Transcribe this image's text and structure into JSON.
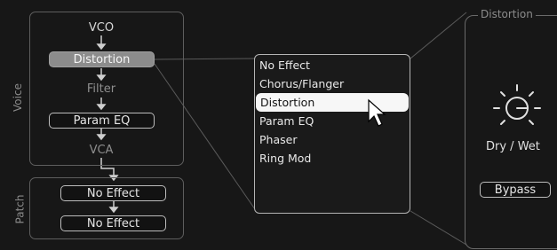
{
  "voice": {
    "group_label": "Voice",
    "chain": [
      "VCO",
      "Distortion",
      "Filter",
      "Param EQ",
      "VCA"
    ]
  },
  "patch": {
    "group_label": "Patch",
    "slots": [
      "No Effect",
      "No Effect"
    ]
  },
  "effect_menu": {
    "items": [
      "No Effect",
      "Chorus/Flanger",
      "Distortion",
      "Param EQ",
      "Phaser",
      "Ring Mod"
    ],
    "highlighted_index": 2
  },
  "distortion_panel": {
    "title": "Distortion",
    "knob_label": "Dry / Wet",
    "bypass_label": "Bypass"
  }
}
